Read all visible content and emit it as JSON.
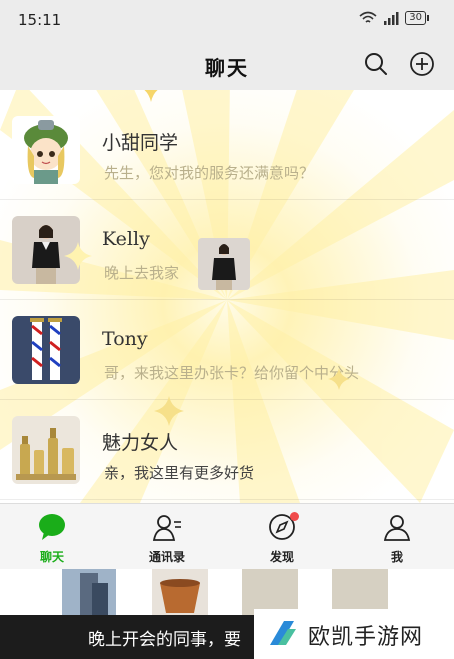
{
  "status_bar": {
    "time": "15:11",
    "battery": "30"
  },
  "header": {
    "title": "聊天",
    "search_icon": "search-icon",
    "add_icon": "add-circle-icon"
  },
  "chats": [
    {
      "name": "小甜同学",
      "message": "先生，您对我的服务还满意吗？",
      "avatar": "anime-girl-avatar"
    },
    {
      "name": "Kelly",
      "message": "晚上去我家",
      "avatar": "woman-photo-avatar"
    },
    {
      "name": "Tony",
      "message": "哥，来我这里办张卡？给你留个中分头",
      "avatar": "barber-pole-avatar"
    },
    {
      "name": "魅力女人",
      "message": "亲，我这里有更多好货",
      "avatar": "cosmetics-avatar"
    }
  ],
  "tabs": [
    {
      "label": "聊天",
      "icon": "chat-bubble-icon",
      "active": true
    },
    {
      "label": "通讯录",
      "icon": "contacts-icon",
      "active": false
    },
    {
      "label": "发现",
      "icon": "compass-icon",
      "active": false
    },
    {
      "label": "我",
      "icon": "person-icon",
      "active": false
    }
  ],
  "caption": {
    "text": "晚上开会的同事，要"
  },
  "watermark": {
    "text": "欧凯手游网"
  },
  "colors": {
    "accent": "#1aad19",
    "badge": "#f04a4a",
    "header_bg": "#ececec"
  }
}
